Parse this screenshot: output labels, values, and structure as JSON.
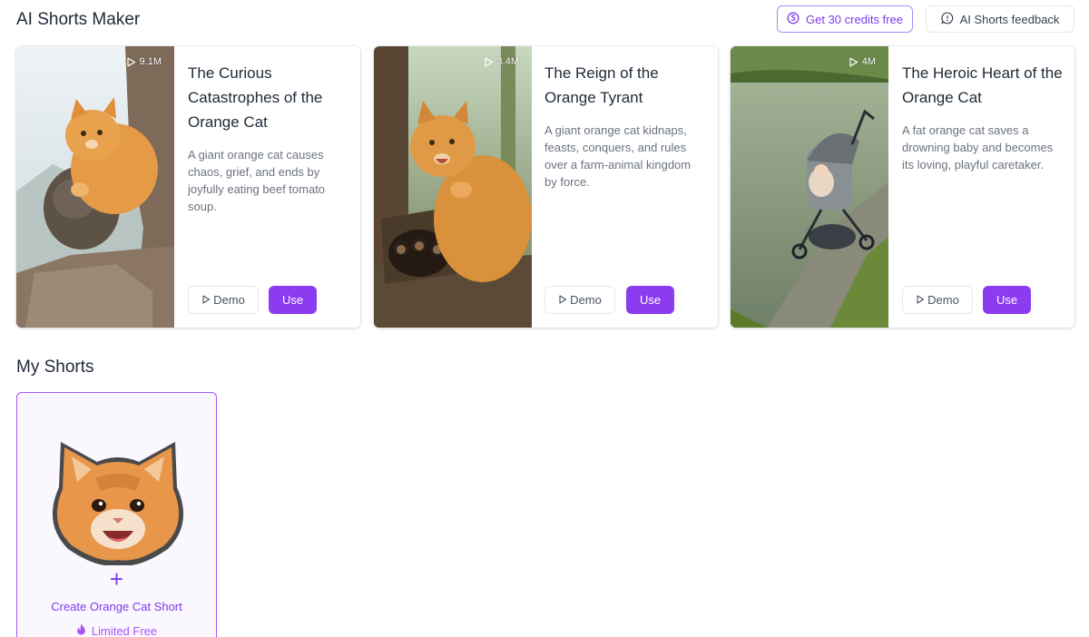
{
  "header": {
    "title": "AI Shorts Maker",
    "credits_label": "Get 30 credits free",
    "credits_icon": "coin-icon",
    "feedback_label": "AI Shorts feedback",
    "feedback_icon": "chat-bubble-icon"
  },
  "templates": [
    {
      "title": "The Curious Catastrophes of the Orange Cat",
      "views": "9.1M",
      "description": "A giant orange cat causes chaos, grief, and ends by joyfully eating beef tomato soup.",
      "demo_label": "Demo",
      "use_label": "Use"
    },
    {
      "title": "The Reign of the Orange Tyrant",
      "views": "3.4M",
      "description": "A giant orange cat kidnaps, feasts, conquers, and rules over a farm-animal kingdom by force.",
      "demo_label": "Demo",
      "use_label": "Use"
    },
    {
      "title": "The Heroic Heart of the Orange Cat",
      "views": "4M",
      "description": "A fat orange cat saves a drowning baby and becomes its loving, playful caretaker.",
      "demo_label": "Demo",
      "use_label": "Use"
    }
  ],
  "my_shorts": {
    "title": "My Shorts",
    "create_label": "Create Orange Cat Short",
    "plus": "+",
    "limited_label": "Limited Free",
    "limited_icon": "fire-icon"
  },
  "colors": {
    "accent": "#8b3cf0",
    "accent_text": "#7c3aed",
    "card_bg": "#ffffff",
    "create_bg": "#fbf7ff"
  }
}
